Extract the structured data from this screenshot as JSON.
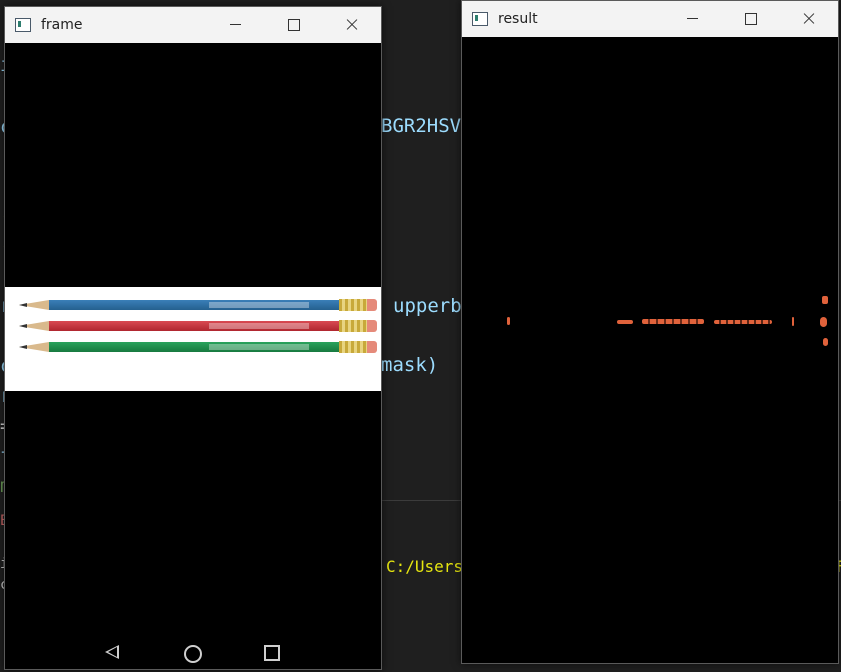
{
  "editor": {
    "code_fragments": {
      "bgr2hsv": "BGR2HSV",
      "upperb": "upperb",
      "mask": "mask)"
    },
    "terminal_path": "C:/Users/",
    "gutter_glyphs": [
      "i",
      "c",
      "(",
      "(",
      "r",
      "c",
      "r",
      "=",
      "f",
      "m",
      "E",
      "i",
      "c"
    ]
  },
  "frame_window": {
    "title": "frame",
    "nav": {
      "back": "back",
      "home": "home",
      "recent": "recent-apps"
    }
  },
  "result_window": {
    "title": "result"
  },
  "colors": {
    "pencil_blue": "#2f6fa3",
    "pencil_red": "#c8323c",
    "pencil_green": "#1f8f4d",
    "mask_orange": "#e0623b"
  }
}
